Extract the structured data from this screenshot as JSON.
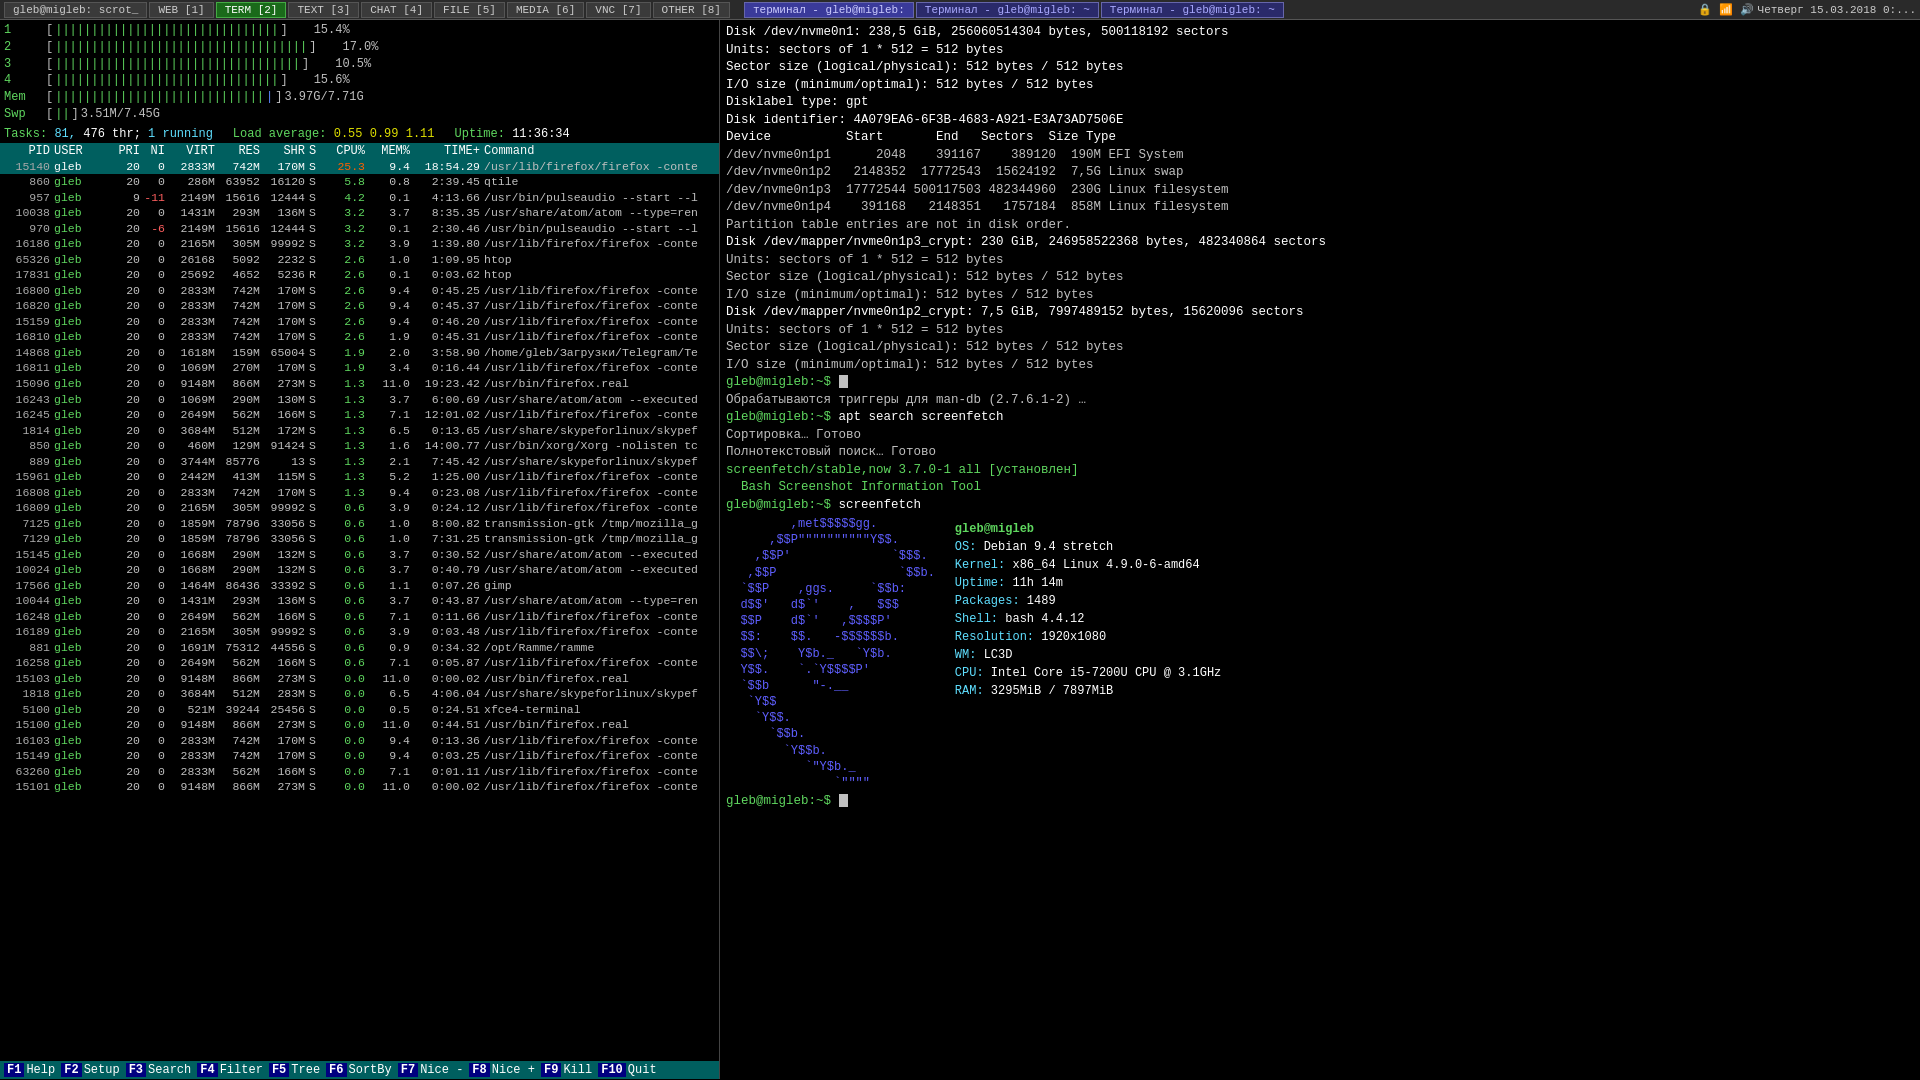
{
  "taskbar": {
    "items": [
      {
        "label": "gleb@migleb: scrot_",
        "active": false
      },
      {
        "label": "WEB [1]",
        "active": false
      },
      {
        "label": "TERM [2]",
        "active": true
      },
      {
        "label": "TEXT [3]",
        "active": false
      },
      {
        "label": "CHAT [4]",
        "active": false
      },
      {
        "label": "FILE [5]",
        "active": false
      },
      {
        "label": "MEDIA [6]",
        "active": false
      },
      {
        "label": "VNC [7]",
        "active": false
      },
      {
        "label": "OTHER [8]",
        "active": false
      }
    ],
    "terminals": [
      {
        "label": "терминал - gleb@migleb:",
        "active": true
      },
      {
        "label": "Терминал - gleb@migleb: ~",
        "active": false
      },
      {
        "label": "Терминал - gleb@migleb: ~",
        "active": false
      }
    ],
    "right": {
      "icons": [
        "🔒",
        "📶",
        "🔊"
      ],
      "datetime": "Четверг 15.03.2018 0:..."
    }
  },
  "htop": {
    "cpu_bars": [
      {
        "label": "1",
        "fill": "|||||||||||||||||||||||||||||||",
        "pct": "15.4%"
      },
      {
        "label": "2",
        "fill": "|||||||||||||||||||||||||||||||||||",
        "pct": "17.0%"
      },
      {
        "label": "3",
        "fill": "||||||||||||||||||||||||||||||||||",
        "pct": "10.5%"
      },
      {
        "label": "4",
        "fill": "|||||||||||||||||||||||||||||||",
        "pct": "15.6%"
      }
    ],
    "mem_bar": {
      "label": "Mem",
      "fill": "||||||||||||||||||||||||||||||",
      "used": "3.97G",
      "total": "7.71G"
    },
    "swp_bar": {
      "label": "Swp",
      "fill": "||",
      "used": "3.51M",
      "total": "7.45G"
    },
    "tasks_label": "Tasks:",
    "tasks_count": "81,",
    "tasks_thr": "476 thr;",
    "tasks_running": "1 running",
    "load_label": "Load average:",
    "load_values": "0.55 0.99 1.11",
    "uptime_label": "Uptime:",
    "uptime_value": "11:36:34",
    "columns": [
      "PID",
      "USER",
      "PRI",
      "NI",
      "VIRT",
      "RES",
      "SHR",
      "S",
      "CPU%",
      "MEM%",
      "TIME+",
      "Command"
    ],
    "processes": [
      {
        "pid": "15140",
        "user": "gleb",
        "pri": "20",
        "ni": "0",
        "virt": "2833M",
        "res": "742M",
        "shr": "170M",
        "s": "S",
        "cpu": "25.3",
        "mem": "9.4",
        "time": "18:54.29",
        "cmd": "/usr/lib/firefox/firefox -conte",
        "highlight": "green"
      },
      {
        "pid": "860",
        "user": "gleb",
        "pri": "20",
        "ni": "0",
        "virt": "286M",
        "res": "63952",
        "shr": "16120",
        "s": "S",
        "cpu": "5.8",
        "mem": "0.8",
        "time": "2:39.45",
        "cmd": "qtile",
        "highlight": ""
      },
      {
        "pid": "957",
        "user": "gleb",
        "pri": "9",
        "ni": "-11",
        "virt": "2149M",
        "res": "15616",
        "shr": "12444",
        "s": "S",
        "cpu": "4.2",
        "mem": "0.1",
        "time": "4:13.66",
        "cmd": "/usr/bin/pulseaudio --start --l",
        "highlight": ""
      },
      {
        "pid": "10038",
        "user": "gleb",
        "pri": "20",
        "ni": "0",
        "virt": "1431M",
        "res": "293M",
        "shr": "136M",
        "s": "S",
        "cpu": "3.2",
        "mem": "3.7",
        "time": "8:35.35",
        "cmd": "/usr/share/atom/atom --type=ren",
        "highlight": ""
      },
      {
        "pid": "970",
        "user": "gleb",
        "pri": "20",
        "ni": "-6",
        "virt": "2149M",
        "res": "15616",
        "shr": "12444",
        "s": "S",
        "cpu": "3.2",
        "mem": "0.1",
        "time": "2:30.46",
        "cmd": "/usr/bin/pulseaudio --start --l",
        "highlight": ""
      },
      {
        "pid": "16186",
        "user": "gleb",
        "pri": "20",
        "ni": "0",
        "virt": "2165M",
        "res": "305M",
        "shr": "99992",
        "s": "S",
        "cpu": "3.2",
        "mem": "3.9",
        "time": "1:39.80",
        "cmd": "/usr/lib/firefox/firefox -conte",
        "highlight": ""
      },
      {
        "pid": "65326",
        "user": "gleb",
        "pri": "20",
        "ni": "0",
        "virt": "26168",
        "res": "5092",
        "shr": "2232",
        "s": "S",
        "cpu": "2.6",
        "mem": "1.0",
        "time": "1:09.95",
        "cmd": "htop",
        "highlight": ""
      },
      {
        "pid": "17831",
        "user": "gleb",
        "pri": "20",
        "ni": "0",
        "virt": "25692",
        "res": "4652",
        "shr": "5236",
        "s": "R",
        "cpu": "2.6",
        "mem": "0.1",
        "time": "0:03.62",
        "cmd": "htop",
        "highlight": ""
      },
      {
        "pid": "16800",
        "user": "gleb",
        "pri": "20",
        "ni": "0",
        "virt": "2833M",
        "res": "742M",
        "shr": "170M",
        "s": "S",
        "cpu": "2.6",
        "mem": "9.4",
        "time": "0:45.25",
        "cmd": "/usr/lib/firefox/firefox -conte",
        "highlight": ""
      },
      {
        "pid": "16820",
        "user": "gleb",
        "pri": "20",
        "ni": "0",
        "virt": "2833M",
        "res": "742M",
        "shr": "170M",
        "s": "S",
        "cpu": "2.6",
        "mem": "9.4",
        "time": "0:45.37",
        "cmd": "/usr/lib/firefox/firefox -conte",
        "highlight": ""
      },
      {
        "pid": "15159",
        "user": "gleb",
        "pri": "20",
        "ni": "0",
        "virt": "2833M",
        "res": "742M",
        "shr": "170M",
        "s": "S",
        "cpu": "2.6",
        "mem": "9.4",
        "time": "0:46.20",
        "cmd": "/usr/lib/firefox/firefox -conte",
        "highlight": ""
      },
      {
        "pid": "16810",
        "user": "gleb",
        "pri": "20",
        "ni": "0",
        "virt": "2833M",
        "res": "742M",
        "shr": "170M",
        "s": "S",
        "cpu": "2.6",
        "mem": "1.9",
        "time": "0:45.31",
        "cmd": "/usr/lib/firefox/firefox -conte",
        "highlight": ""
      },
      {
        "pid": "14868",
        "user": "gleb",
        "pri": "20",
        "ni": "0",
        "virt": "1618M",
        "res": "159M",
        "shr": "65004",
        "s": "S",
        "cpu": "1.9",
        "mem": "2.0",
        "time": "3:58.90",
        "cmd": "/home/gleb/Загрузки/Telegram/Te",
        "highlight": ""
      },
      {
        "pid": "16811",
        "user": "gleb",
        "pri": "20",
        "ni": "0",
        "virt": "1069M",
        "res": "270M",
        "shr": "170M",
        "s": "S",
        "cpu": "1.9",
        "mem": "3.4",
        "time": "0:16.44",
        "cmd": "/usr/lib/firefox/firefox -conte",
        "highlight": ""
      },
      {
        "pid": "15096",
        "user": "gleb",
        "pri": "20",
        "ni": "0",
        "virt": "9148M",
        "res": "866M",
        "shr": "273M",
        "s": "S",
        "cpu": "1.3",
        "mem": "11.0",
        "time": "19:23.42",
        "cmd": "/usr/bin/firefox.real",
        "highlight": ""
      },
      {
        "pid": "16243",
        "user": "gleb",
        "pri": "20",
        "ni": "0",
        "virt": "1069M",
        "res": "290M",
        "shr": "130M",
        "s": "S",
        "cpu": "1.3",
        "mem": "3.7",
        "time": "6:00.69",
        "cmd": "/usr/share/atom/atom --executed",
        "highlight": ""
      },
      {
        "pid": "16245",
        "user": "gleb",
        "pri": "20",
        "ni": "0",
        "virt": "2649M",
        "res": "562M",
        "shr": "166M",
        "s": "S",
        "cpu": "1.3",
        "mem": "7.1",
        "time": "12:01.02",
        "cmd": "/usr/lib/firefox/firefox -conte",
        "highlight": ""
      },
      {
        "pid": "1814",
        "user": "gleb",
        "pri": "20",
        "ni": "0",
        "virt": "3684M",
        "res": "512M",
        "shr": "172M",
        "s": "S",
        "cpu": "1.3",
        "mem": "6.5",
        "time": "0:13.65",
        "cmd": "/usr/share/skypeforlinux/skypef",
        "highlight": ""
      },
      {
        "pid": "850",
        "user": "gleb",
        "pri": "20",
        "ni": "0",
        "virt": "460M",
        "res": "129M",
        "shr": "91424",
        "s": "S",
        "cpu": "1.3",
        "mem": "1.6",
        "time": "14:00.77",
        "cmd": "/usr/bin/xorg/Xorg -nolisten tc",
        "highlight": ""
      },
      {
        "pid": "889",
        "user": "gleb",
        "pri": "20",
        "ni": "0",
        "virt": "3744M",
        "res": "85776",
        "shr": "13",
        "s": "S",
        "cpu": "1.3",
        "mem": "2.1",
        "time": "7:45.42",
        "cmd": "/usr/share/skypeforlinux/skypef",
        "highlight": ""
      },
      {
        "pid": "15961",
        "user": "gleb",
        "pri": "20",
        "ni": "0",
        "virt": "2442M",
        "res": "413M",
        "shr": "115M",
        "s": "S",
        "cpu": "1.3",
        "mem": "5.2",
        "time": "1:25.00",
        "cmd": "/usr/lib/firefox/firefox -conte",
        "highlight": ""
      },
      {
        "pid": "16808",
        "user": "gleb",
        "pri": "20",
        "ni": "0",
        "virt": "2833M",
        "res": "742M",
        "shr": "170M",
        "s": "S",
        "cpu": "1.3",
        "mem": "9.4",
        "time": "0:23.08",
        "cmd": "/usr/lib/firefox/firefox -conte",
        "highlight": ""
      },
      {
        "pid": "16809",
        "user": "gleb",
        "pri": "20",
        "ni": "0",
        "virt": "2165M",
        "res": "305M",
        "shr": "99992",
        "s": "S",
        "cpu": "0.6",
        "mem": "3.9",
        "time": "0:24.12",
        "cmd": "/usr/lib/firefox/firefox -conte",
        "highlight": ""
      },
      {
        "pid": "7125",
        "user": "gleb",
        "pri": "20",
        "ni": "0",
        "virt": "1859M",
        "res": "78796",
        "shr": "33056",
        "s": "S",
        "cpu": "0.6",
        "mem": "1.0",
        "time": "8:00.82",
        "cmd": "transmission-gtk /tmp/mozilla_g",
        "highlight": ""
      },
      {
        "pid": "7129",
        "user": "gleb",
        "pri": "20",
        "ni": "0",
        "virt": "1859M",
        "res": "78796",
        "shr": "33056",
        "s": "S",
        "cpu": "0.6",
        "mem": "1.0",
        "time": "7:31.25",
        "cmd": "transmission-gtk /tmp/mozilla_g",
        "highlight": ""
      },
      {
        "pid": "15145",
        "user": "gleb",
        "pri": "20",
        "ni": "0",
        "virt": "1668M",
        "res": "290M",
        "shr": "132M",
        "s": "S",
        "cpu": "0.6",
        "mem": "3.7",
        "time": "0:30.52",
        "cmd": "/usr/share/atom/atom --executed",
        "highlight": ""
      },
      {
        "pid": "10024",
        "user": "gleb",
        "pri": "20",
        "ni": "0",
        "virt": "1668M",
        "res": "290M",
        "shr": "132M",
        "s": "S",
        "cpu": "0.6",
        "mem": "3.7",
        "time": "0:40.79",
        "cmd": "/usr/share/atom/atom --executed",
        "highlight": ""
      },
      {
        "pid": "17566",
        "user": "gleb",
        "pri": "20",
        "ni": "0",
        "virt": "1464M",
        "res": "86436",
        "shr": "33392",
        "s": "S",
        "cpu": "0.6",
        "mem": "1.1",
        "time": "0:07.26",
        "cmd": "gimp",
        "highlight": ""
      },
      {
        "pid": "10044",
        "user": "gleb",
        "pri": "20",
        "ni": "0",
        "virt": "1431M",
        "res": "293M",
        "shr": "136M",
        "s": "S",
        "cpu": "0.6",
        "mem": "3.7",
        "time": "0:43.87",
        "cmd": "/usr/share/atom/atom --type=ren",
        "highlight": ""
      },
      {
        "pid": "16248",
        "user": "gleb",
        "pri": "20",
        "ni": "0",
        "virt": "2649M",
        "res": "562M",
        "shr": "166M",
        "s": "S",
        "cpu": "0.6",
        "mem": "7.1",
        "time": "0:11.66",
        "cmd": "/usr/lib/firefox/firefox -conte",
        "highlight": ""
      },
      {
        "pid": "16189",
        "user": "gleb",
        "pri": "20",
        "ni": "0",
        "virt": "2165M",
        "res": "305M",
        "shr": "99992",
        "s": "S",
        "cpu": "0.6",
        "mem": "3.9",
        "time": "0:03.48",
        "cmd": "/usr/lib/firefox/firefox -conte",
        "highlight": ""
      },
      {
        "pid": "881",
        "user": "gleb",
        "pri": "20",
        "ni": "0",
        "virt": "1691M",
        "res": "75312",
        "shr": "44556",
        "s": "S",
        "cpu": "0.6",
        "mem": "0.9",
        "time": "0:34.32",
        "cmd": "/opt/Ramme/ramme",
        "highlight": ""
      },
      {
        "pid": "16258",
        "user": "gleb",
        "pri": "20",
        "ni": "0",
        "virt": "2649M",
        "res": "562M",
        "shr": "166M",
        "s": "S",
        "cpu": "0.6",
        "mem": "7.1",
        "time": "0:05.87",
        "cmd": "/usr/lib/firefox/firefox -conte",
        "highlight": ""
      },
      {
        "pid": "15103",
        "user": "gleb",
        "pri": "20",
        "ni": "0",
        "virt": "9148M",
        "res": "866M",
        "shr": "273M",
        "s": "S",
        "cpu": "0.0",
        "mem": "11.0",
        "time": "0:00.02",
        "cmd": "/usr/bin/firefox.real",
        "highlight": ""
      },
      {
        "pid": "1818",
        "user": "gleb",
        "pri": "20",
        "ni": "0",
        "virt": "3684M",
        "res": "512M",
        "shr": "283M",
        "s": "S",
        "cpu": "0.0",
        "mem": "6.5",
        "time": "4:06.04",
        "cmd": "/usr/share/skypeforlinux/skypef",
        "highlight": ""
      },
      {
        "pid": "5100",
        "user": "gleb",
        "pri": "20",
        "ni": "0",
        "virt": "521M",
        "res": "39244",
        "shr": "25456",
        "s": "S",
        "cpu": "0.0",
        "mem": "0.5",
        "time": "0:24.51",
        "cmd": "xfce4-terminal",
        "highlight": ""
      },
      {
        "pid": "15100",
        "user": "gleb",
        "pri": "20",
        "ni": "0",
        "virt": "9148M",
        "res": "866M",
        "shr": "273M",
        "s": "S",
        "cpu": "0.0",
        "mem": "11.0",
        "time": "0:44.51",
        "cmd": "/usr/bin/firefox.real",
        "highlight": ""
      },
      {
        "pid": "16103",
        "user": "gleb",
        "pri": "20",
        "ni": "0",
        "virt": "2833M",
        "res": "742M",
        "shr": "170M",
        "s": "S",
        "cpu": "0.0",
        "mem": "9.4",
        "time": "0:13.36",
        "cmd": "/usr/lib/firefox/firefox -conte",
        "highlight": ""
      },
      {
        "pid": "15149",
        "user": "gleb",
        "pri": "20",
        "ni": "0",
        "virt": "2833M",
        "res": "742M",
        "shr": "170M",
        "s": "S",
        "cpu": "0.0",
        "mem": "9.4",
        "time": "0:03.25",
        "cmd": "/usr/lib/firefox/firefox -conte",
        "highlight": ""
      },
      {
        "pid": "63260",
        "user": "gleb",
        "pri": "20",
        "ni": "0",
        "virt": "2833M",
        "res": "562M",
        "shr": "166M",
        "s": "S",
        "cpu": "0.0",
        "mem": "7.1",
        "time": "0:01.11",
        "cmd": "/usr/lib/firefox/firefox -conte",
        "highlight": ""
      },
      {
        "pid": "15101",
        "user": "gleb",
        "pri": "20",
        "ni": "0",
        "virt": "9148M",
        "res": "866M",
        "shr": "273M",
        "s": "S",
        "cpu": "0.0",
        "mem": "11.0",
        "time": "0:00.02",
        "cmd": "/usr/lib/firefox/firefox -conte",
        "highlight": ""
      }
    ],
    "fkeys": [
      {
        "num": "F1",
        "label": "Help"
      },
      {
        "num": "F2",
        "label": "Setup"
      },
      {
        "num": "F3",
        "label": "Search"
      },
      {
        "num": "F4",
        "label": "Filter"
      },
      {
        "num": "F5",
        "label": "Tree"
      },
      {
        "num": "F6",
        "label": "SortBy"
      },
      {
        "num": "F7",
        "label": "Nice -"
      },
      {
        "num": "F8",
        "label": "Nice +"
      },
      {
        "num": "F9",
        "label": "Kill"
      },
      {
        "num": "F10",
        "label": "Quit"
      }
    ]
  },
  "terminal": {
    "disk_lines": [
      "Disk /dev/nvme0n1: 238,5 GiB, 256060514304 bytes, 500118192 sectors",
      "Units: sectors of 1 * 512 = 512 bytes",
      "Sector size (logical/physical): 512 bytes / 512 bytes",
      "I/O size (minimum/optimal): 512 bytes / 512 bytes",
      "Disklabel type: gpt",
      "Disk identifier: 4A079EA6-6F3B-4683-A921-E3A73AD7506E"
    ],
    "partition_table_header": "Device          Start       End   Sectors  Size Type",
    "partitions": [
      "/dev/nvme0n1p1      2048    391167    389120  190M EFI System",
      "/dev/nvme0n1p2   2148352  17772543  15624192  7,5G Linux swap",
      "/dev/nvme0n1p3  17772544 500117503 482344960  230G Linux filesystem",
      "/dev/nvme0n1p4    391168   2148351   1757184  858M Linux filesystem"
    ],
    "partition_note": "Partition table entries are not in disk order.",
    "disk2_lines": [
      "Disk /dev/mapper/nvme0n1p3_crypt: 230 GiB, 246958522368 bytes, 482340864 sectors",
      "Units: sectors of 1 * 512 = 512 bytes",
      "Sector size (logical/physical): 512 bytes / 512 bytes",
      "I/O size (minimum/optimal): 512 bytes / 512 bytes"
    ],
    "disk3_lines": [
      "Disk /dev/mapper/nvme0n1p2_crypt: 7,5 GiB, 7997489152 bytes, 15620096 sectors",
      "Units: sectors of 1 * 512 = 512 bytes",
      "Sector size (logical/physical): 512 bytes / 512 bytes",
      "I/O size (minimum/optimal): 512 bytes / 512 bytes"
    ],
    "prompt1": "gleb@migleb:~$",
    "apt_lines": [
      "Обрабатываются триггеры для man-db (2.7.6.1-2) …",
      "gleb@migleb:~$ apt search screenfetch",
      "Сортировка… Готово",
      "Полнотекстовый поиск… Готово",
      "screenfetch/stable,now 3.7.0-1 all [установлен]",
      "  Bash Screenshot Information Tool"
    ],
    "prompt2": "gleb@migleb:~$ screenfetch",
    "screenfetch_art": [
      "         ,met$$$$$gg.",
      "      ,$$P\"\"\"\"\"\"\"\"\"\"Y$$.",
      "    ,$$P'              `$$$.",
      "   ,$$P                 `$$b.",
      "  `$$P    ,ggs.     `$$b:",
      "  d$$'   d$`'    ,   $$$",
      "  $$P    d$`'   ,$$$$P'",
      "  $$:    $$.   -$$$$$$b.",
      "  $$\\;    Y$b._   `Y$b.",
      "  Y$$.    `.`Y$$$$P'",
      "  `$$b      \"-.__",
      "   `Y$$",
      "    `Y$$.",
      "      `$$b.",
      "        `Y$$b.",
      "           `\"Y$b._",
      "               `\"\"\"\""
    ],
    "screenfetch_info": {
      "user_host": "gleb@migleb",
      "os_label": "OS:",
      "os_val": "Debian 9.4 stretch",
      "kernel_label": "Kernel:",
      "kernel_val": "x86_64 Linux 4.9.0-6-amd64",
      "uptime_label": "Uptime:",
      "uptime_val": "11h 14m",
      "packages_label": "Packages:",
      "packages_val": "1489",
      "shell_label": "Shell:",
      "shell_val": "bash 4.4.12",
      "resolution_label": "Resolution:",
      "resolution_val": "1920x1080",
      "wm_label": "WM:",
      "wm_val": "LC3D",
      "cpu_label": "CPU:",
      "cpu_val": "Intel Core i5-7200U CPU @ 3.1GHz",
      "ram_label": "RAM:",
      "ram_val": "3295MiB / 7897MiB"
    },
    "final_prompt": "gleb@migleb:~$"
  }
}
